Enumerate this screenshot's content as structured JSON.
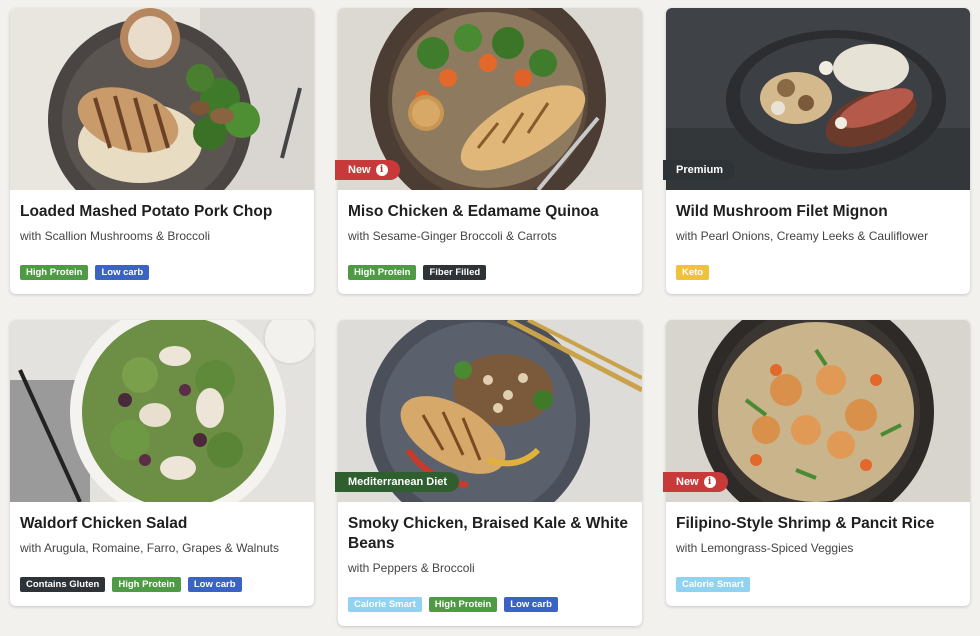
{
  "colors": {
    "page_background": "#f2f1ee",
    "badge_new": "#c83a3a",
    "badge_premium": "#2e3338",
    "badge_mediterranean": "#2f5f2e",
    "tag_high_protein": "#4f9a44",
    "tag_low_carb": "#3b63c7",
    "tag_fiber_filled": "#2e3338",
    "tag_keto": "#f0c23a",
    "tag_contains_gluten": "#2e3338",
    "tag_calorie_smart": "#8fd3f0"
  },
  "meals": [
    {
      "title": "Loaded Mashed Potato Pork Chop",
      "subtitle": "with Scallion Mushrooms & Broccoli",
      "badge": null,
      "tags": [
        {
          "label": "High Protein",
          "color": "#4f9a44"
        },
        {
          "label": "Low carb",
          "color": "#3b63c7"
        }
      ],
      "image_icon": "pork-chop-plate"
    },
    {
      "title": "Miso Chicken & Edamame Quinoa",
      "subtitle": "with Sesame-Ginger Broccoli & Carrots",
      "badge": {
        "label": "New",
        "color": "#c83a3a",
        "info": true
      },
      "tags": [
        {
          "label": "High Protein",
          "color": "#4f9a44"
        },
        {
          "label": "Fiber Filled",
          "color": "#2e3338"
        }
      ],
      "image_icon": "miso-chicken-bowl"
    },
    {
      "title": "Wild Mushroom Filet Mignon",
      "subtitle": "with Pearl Onions, Creamy Leeks & Cauliflower",
      "badge": {
        "label": "Premium",
        "color": "#2e3338",
        "info": false
      },
      "tags": [
        {
          "label": "Keto",
          "color": "#f0c23a"
        }
      ],
      "image_icon": "filet-mignon-plate"
    },
    {
      "title": "Waldorf Chicken Salad",
      "subtitle": "with Arugula, Romaine, Farro, Grapes & Walnuts",
      "badge": null,
      "tags": [
        {
          "label": "Contains Gluten",
          "color": "#2e3338"
        },
        {
          "label": "High Protein",
          "color": "#4f9a44"
        },
        {
          "label": "Low carb",
          "color": "#3b63c7"
        }
      ],
      "image_icon": "waldorf-salad-bowl"
    },
    {
      "title": "Smoky Chicken, Braised Kale & White Beans",
      "subtitle": "with Peppers & Broccoli",
      "badge": {
        "label": "Mediterranean Diet",
        "color": "#2f5f2e",
        "info": false
      },
      "tags": [
        {
          "label": "Calorie Smart",
          "color": "#8fd3f0"
        },
        {
          "label": "High Protein",
          "color": "#4f9a44"
        },
        {
          "label": "Low carb",
          "color": "#3b63c7"
        }
      ],
      "image_icon": "smoky-chicken-plate"
    },
    {
      "title": "Filipino-Style Shrimp & Pancit Rice",
      "subtitle": "with Lemongrass-Spiced Veggies",
      "badge": {
        "label": "New",
        "color": "#c83a3a",
        "info": true
      },
      "tags": [
        {
          "label": "Calorie Smart",
          "color": "#8fd3f0"
        }
      ],
      "image_icon": "shrimp-pancit-bowl"
    }
  ]
}
